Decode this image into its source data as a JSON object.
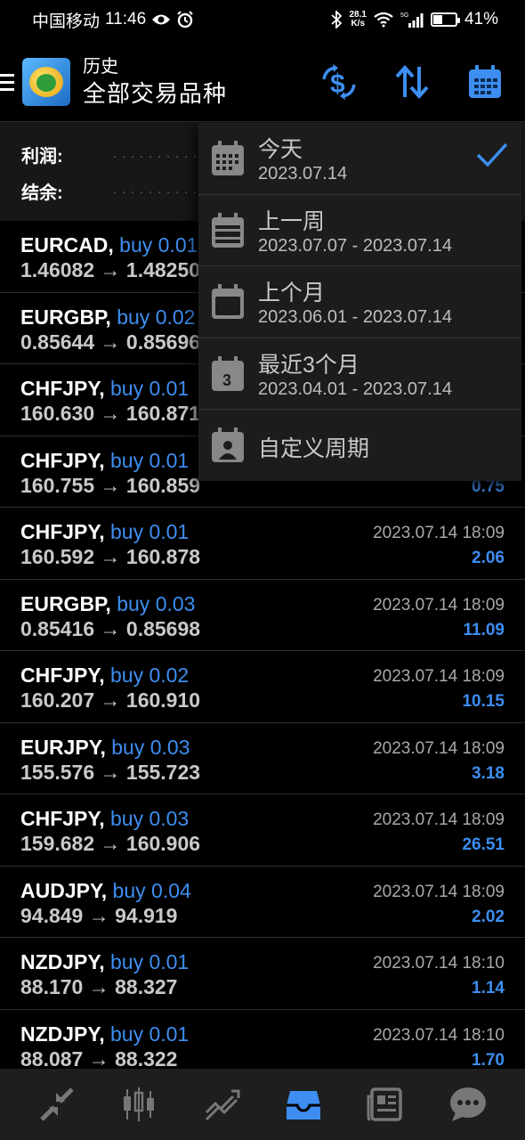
{
  "status_bar": {
    "carrier": "中国移动",
    "time": "11:46",
    "net_speed_value": "28.1",
    "net_speed_unit": "K/s",
    "network": "5G",
    "battery": "41%"
  },
  "header": {
    "title": "历史",
    "subtitle": "全部交易品种"
  },
  "summary": {
    "profit_label": "利润:",
    "balance_label": "结余:"
  },
  "trades": [
    {
      "symbol": "EURCAD,",
      "side": "buy 0.01",
      "prices": "1.46082 → 1.48250",
      "time": "",
      "profit": ""
    },
    {
      "symbol": "EURGBP,",
      "side": "buy 0.02",
      "prices": "0.85644 → 0.85696",
      "time": "",
      "profit": ""
    },
    {
      "symbol": "CHFJPY,",
      "side": "buy 0.01",
      "prices": "160.630 → 160.871",
      "time": "",
      "profit": ""
    },
    {
      "symbol": "CHFJPY,",
      "side": "buy 0.01",
      "prices": "160.755 → 160.859",
      "time": "",
      "profit": "0.75"
    },
    {
      "symbol": "CHFJPY,",
      "side": "buy 0.01",
      "prices": "160.592 → 160.878",
      "time": "2023.07.14 18:09",
      "profit": "2.06"
    },
    {
      "symbol": "EURGBP,",
      "side": "buy 0.03",
      "prices": "0.85416 → 0.85698",
      "time": "2023.07.14 18:09",
      "profit": "11.09"
    },
    {
      "symbol": "CHFJPY,",
      "side": "buy 0.02",
      "prices": "160.207 → 160.910",
      "time": "2023.07.14 18:09",
      "profit": "10.15"
    },
    {
      "symbol": "EURJPY,",
      "side": "buy 0.03",
      "prices": "155.576 → 155.723",
      "time": "2023.07.14 18:09",
      "profit": "3.18"
    },
    {
      "symbol": "CHFJPY,",
      "side": "buy 0.03",
      "prices": "159.682 → 160.906",
      "time": "2023.07.14 18:09",
      "profit": "26.51"
    },
    {
      "symbol": "AUDJPY,",
      "side": "buy 0.04",
      "prices": "94.849 → 94.919",
      "time": "2023.07.14 18:09",
      "profit": "2.02"
    },
    {
      "symbol": "NZDJPY,",
      "side": "buy 0.01",
      "prices": "88.170 → 88.327",
      "time": "2023.07.14 18:10",
      "profit": "1.14"
    },
    {
      "symbol": "NZDJPY,",
      "side": "buy 0.01",
      "prices": "88.087 → 88.322",
      "time": "2023.07.14 18:10",
      "profit": "1.70"
    }
  ],
  "period_menu": {
    "items": [
      {
        "label": "今天",
        "range": "2023.07.14",
        "icon": "calendar-day-icon",
        "selected": true
      },
      {
        "label": "上一周",
        "range": "2023.07.07 - 2023.07.14",
        "icon": "calendar-week-icon",
        "selected": false
      },
      {
        "label": "上个月",
        "range": "2023.06.01 - 2023.07.14",
        "icon": "calendar-month-icon",
        "selected": false
      },
      {
        "label": "最近3个月",
        "range": "2023.04.01 - 2023.07.14",
        "icon": "calendar-3-months-icon",
        "icon_text": "3",
        "selected": false
      },
      {
        "label": "自定义周期",
        "range": "",
        "icon": "calendar-custom-icon",
        "selected": false
      }
    ]
  },
  "bottom_nav": [
    "quotes-icon",
    "chart-icon",
    "trade-icon",
    "history-icon",
    "news-icon",
    "chat-icon"
  ],
  "colors": {
    "accent": "#3d8ef0",
    "background": "#000000",
    "menu_background": "#1c1c1c",
    "bottom_nav_background": "#1e1e1e"
  }
}
